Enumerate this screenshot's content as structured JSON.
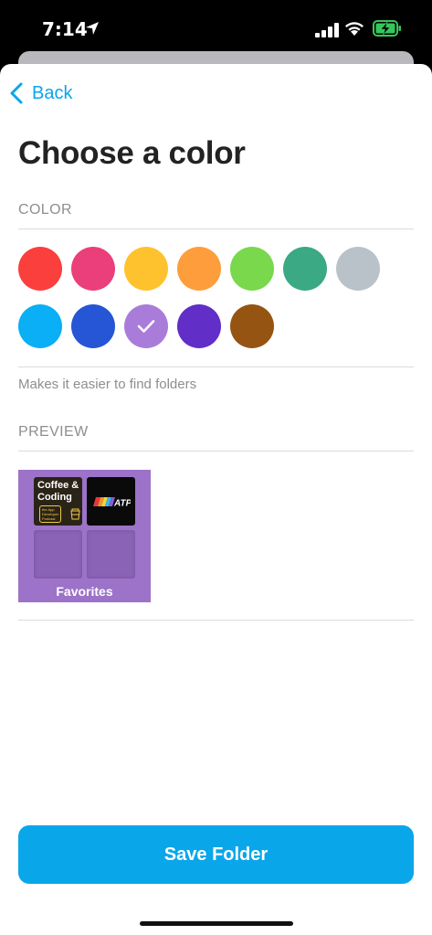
{
  "status_bar": {
    "time": "7:14",
    "icons": [
      "location-arrow-icon",
      "cellular-signal-icon",
      "wifi-icon",
      "battery-charging-icon"
    ],
    "battery_color": "#34c759"
  },
  "nav": {
    "back_label": "Back",
    "back_icon": "chevron-left-icon"
  },
  "page": {
    "title": "Choose a color"
  },
  "color_section": {
    "label": "COLOR",
    "helper": "Makes it easier to find folders",
    "selected": "#a97cd9",
    "swatches": [
      {
        "name": "red",
        "color": "#fa3f3d"
      },
      {
        "name": "pink",
        "color": "#ea3f7a"
      },
      {
        "name": "yellow",
        "color": "#fec22e"
      },
      {
        "name": "orange",
        "color": "#fe9d3b"
      },
      {
        "name": "green",
        "color": "#79d84b"
      },
      {
        "name": "teal",
        "color": "#3aa984"
      },
      {
        "name": "gray",
        "color": "#b8c2c8"
      },
      {
        "name": "sky-blue",
        "color": "#0aaff5"
      },
      {
        "name": "blue",
        "color": "#2655d5"
      },
      {
        "name": "lavender",
        "color": "#a97cd9"
      },
      {
        "name": "purple",
        "color": "#612ec8"
      },
      {
        "name": "brown",
        "color": "#965412"
      }
    ]
  },
  "preview_section": {
    "label": "PREVIEW",
    "folder_name": "Favorites",
    "tile_color": "#9c73c8",
    "podcasts": [
      {
        "title_line1": "Coffee &",
        "title_line2": "Coding",
        "subtitle_line1": "the App",
        "subtitle_line2": "Developer",
        "subtitle_line3": "Podcast"
      },
      {
        "title": "ATP"
      }
    ]
  },
  "actions": {
    "save_label": "Save Folder",
    "accent": "#0aa6ea"
  }
}
